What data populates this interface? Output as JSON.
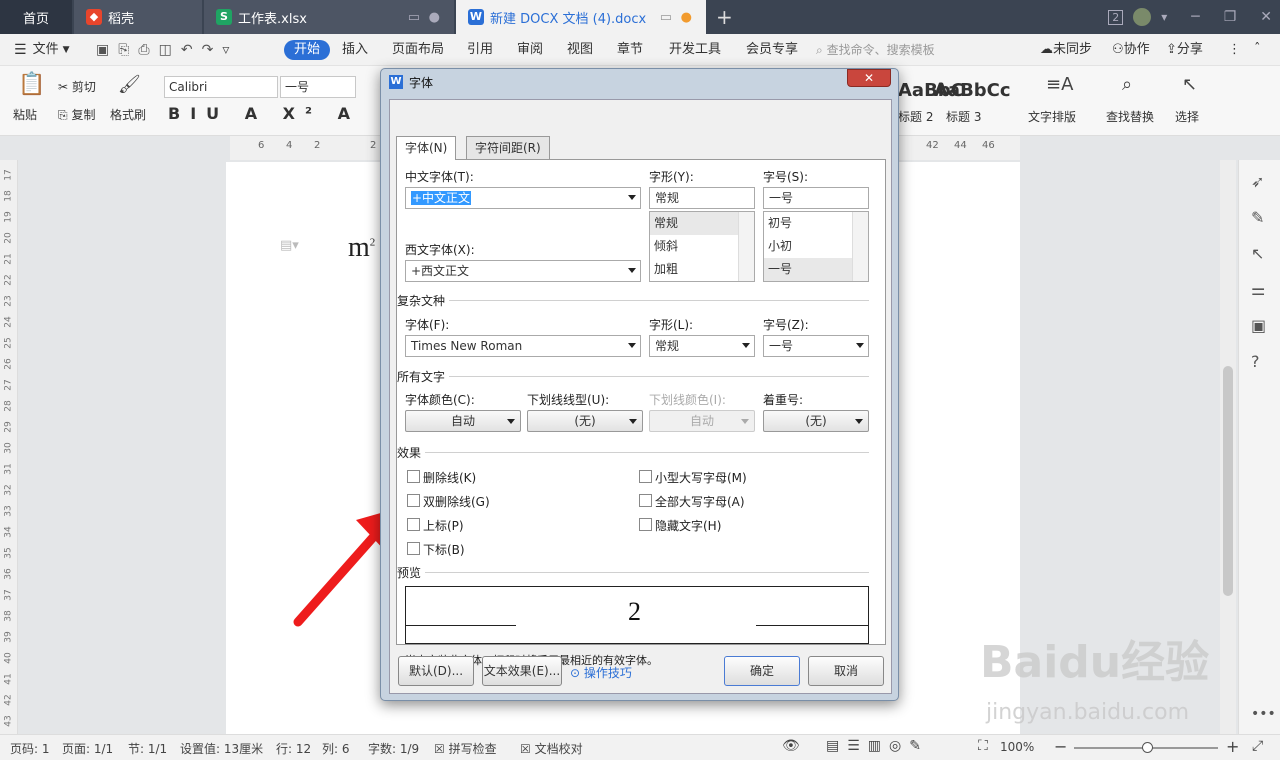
{
  "tabs": {
    "home": "首页",
    "t1": "稻壳",
    "t2": "工作表.xlsx",
    "t3": "新建 DOCX 文档 (4).docx",
    "window_count": "2"
  },
  "menu": {
    "file": "文件",
    "items": [
      "开始",
      "插入",
      "页面布局",
      "引用",
      "审阅",
      "视图",
      "章节",
      "开发工具",
      "会员专享"
    ],
    "search": "查找命令、搜索模板",
    "sync": "未同步",
    "collab": "协作",
    "share": "分享"
  },
  "ribbon": {
    "paste": "粘贴",
    "cut": "剪切",
    "copy": "复制",
    "format_painter": "格式刷",
    "font_name": "Calibri",
    "font_size": "一号",
    "style_preview1": "AaBbC",
    "style_preview2": "AaBbCc",
    "heading2": "标题 2",
    "heading3": "标题 3",
    "text_layout": "文字排版",
    "find_replace": "查找替换",
    "select": "选择"
  },
  "ruler": {
    "left": [
      "6",
      "4",
      "2",
      "2"
    ],
    "right": [
      "42",
      "44",
      "46"
    ],
    "vertical": [
      "17",
      "18",
      "19",
      "20",
      "21",
      "22",
      "23",
      "24",
      "25",
      "26",
      "27",
      "28",
      "29",
      "30",
      "31",
      "32",
      "33",
      "34",
      "35",
      "36",
      "37",
      "38",
      "39",
      "40",
      "41",
      "42",
      "43"
    ]
  },
  "document": {
    "text": "m",
    "sup": "2"
  },
  "dialog": {
    "title": "字体",
    "tab_font": "字体(N)",
    "tab_spacing": "字符间距(R)",
    "cn_font_label": "中文字体(T):",
    "cn_font_value": "+中文正文",
    "style_label": "字形(Y):",
    "style_value": "常规",
    "style_list": [
      "常规",
      "倾斜",
      "加粗"
    ],
    "size_label": "字号(S):",
    "size_value": "一号",
    "size_list": [
      "初号",
      "小初",
      "一号"
    ],
    "west_font_label": "西文字体(X):",
    "west_font_value": "+西文正文",
    "complex_section": "复杂文种",
    "complex_font_label": "字体(F):",
    "complex_font_value": "Times New Roman",
    "complex_style_label": "字形(L):",
    "complex_style_value": "常规",
    "complex_size_label": "字号(Z):",
    "complex_size_value": "一号",
    "all_text_section": "所有文字",
    "font_color_label": "字体颜色(C):",
    "font_color_value": "自动",
    "underline_label": "下划线线型(U):",
    "underline_value": "(无)",
    "underline_color_label": "下划线颜色(I):",
    "underline_color_value": "自动",
    "emphasis_label": "着重号:",
    "emphasis_value": "(无)",
    "effects_section": "效果",
    "effects_left": [
      "删除线(K)",
      "双删除线(G)",
      "上标(P)",
      "下标(B)"
    ],
    "effects_right": [
      "小型大写字母(M)",
      "全部大写字母(A)",
      "隐藏文字(H)"
    ],
    "preview_section": "预览",
    "preview_text": "2",
    "note": "尚未安装此字体，打印时将采用最相近的有效字体。",
    "btn_default": "默认(D)...",
    "btn_text_effect": "文本效果(E)...",
    "btn_tips": "操作技巧",
    "btn_ok": "确定",
    "btn_cancel": "取消"
  },
  "status": {
    "page_no": "页码: 1",
    "pages": "页面: 1/1",
    "section": "节: 1/1",
    "setting": "设置值: 13厘米",
    "row": "行: 12",
    "col": "列: 6",
    "words": "字数: 1/9",
    "spell": "拼写检查",
    "proof": "文档校对",
    "zoom": "100%"
  },
  "watermark": {
    "brand": "Baidu经验",
    "url": "jingyan.baidu.com"
  },
  "colors": {
    "accent": "#2b6fd6",
    "arrow": "#ee1c1c",
    "tabbar": "#3b4452"
  }
}
